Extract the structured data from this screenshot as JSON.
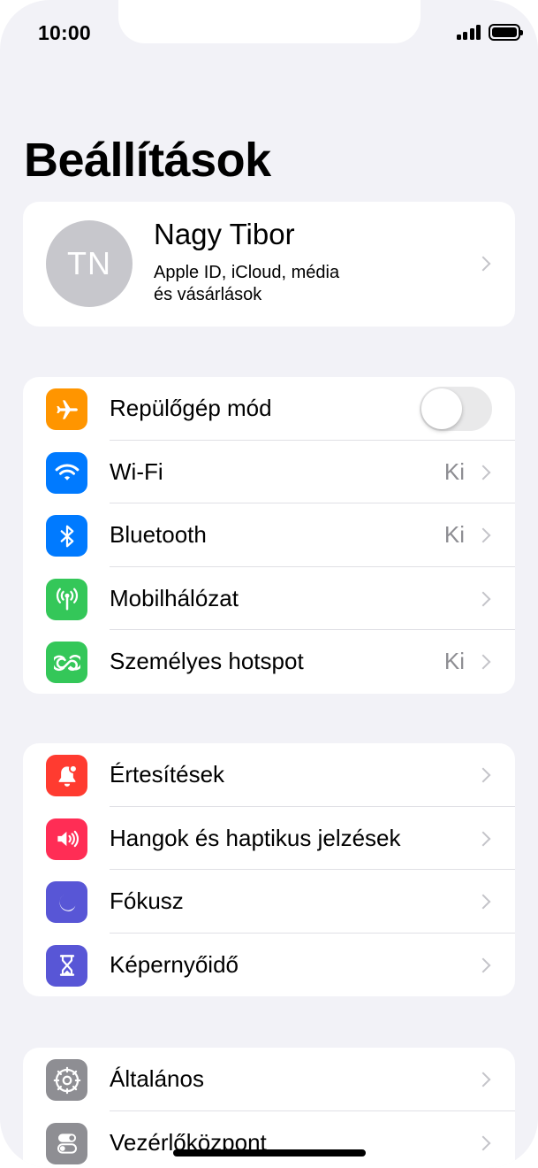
{
  "status_bar": {
    "time": "10:00"
  },
  "page": {
    "title": "Beállítások"
  },
  "profile": {
    "initials": "TN",
    "name": "Nagy Tibor",
    "subtitle_line1": "Apple ID, iCloud, média",
    "subtitle_line2": "és vásárlások"
  },
  "connectivity": [
    {
      "label": "Repülőgép mód",
      "icon": "airplane-icon",
      "color": "#ff9500",
      "toggle": false
    },
    {
      "label": "Wi-Fi",
      "icon": "wifi-icon",
      "color": "#007aff",
      "value": "Ki"
    },
    {
      "label": "Bluetooth",
      "icon": "bluetooth-icon",
      "color": "#007aff",
      "value": "Ki"
    },
    {
      "label": "Mobilhálózat",
      "icon": "antenna-icon",
      "color": "#34c759"
    },
    {
      "label": "Személyes hotspot",
      "icon": "hotspot-icon",
      "color": "#34c759",
      "value": "Ki"
    }
  ],
  "notifications": [
    {
      "label": "Értesítések",
      "icon": "bell-icon",
      "color": "#ff3b30"
    },
    {
      "label": "Hangok és haptikus jelzések",
      "icon": "speaker-icon",
      "color": "#ff2d55"
    },
    {
      "label": "Fókusz",
      "icon": "moon-icon",
      "color": "#5856d6"
    },
    {
      "label": "Képernyőidő",
      "icon": "hourglass-icon",
      "color": "#5856d6"
    }
  ],
  "general": [
    {
      "label": "Általános",
      "icon": "gear-icon",
      "color": "#8e8e93"
    },
    {
      "label": "Vezérlőközpont",
      "icon": "switches-icon",
      "color": "#8e8e93"
    }
  ]
}
